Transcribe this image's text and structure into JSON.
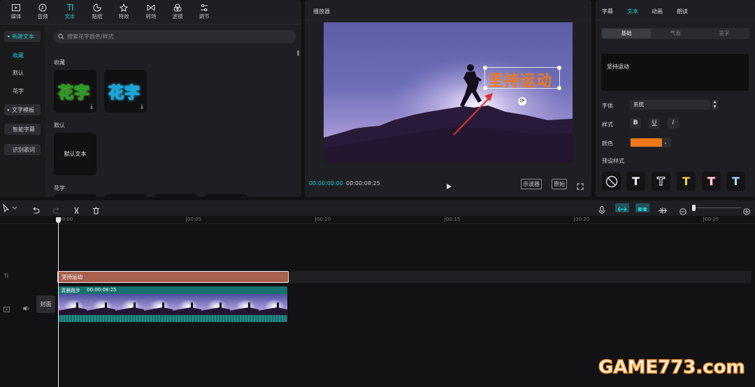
{
  "toolbar": {
    "items": [
      {
        "label": "媒体",
        "icon": "media-icon"
      },
      {
        "label": "音频",
        "icon": "audio-icon"
      },
      {
        "label": "文本",
        "icon": "text-icon",
        "active": true
      },
      {
        "label": "贴纸",
        "icon": "sticker-icon"
      },
      {
        "label": "特效",
        "icon": "effects-icon"
      },
      {
        "label": "转场",
        "icon": "transition-icon"
      },
      {
        "label": "滤镜",
        "icon": "filter-icon"
      },
      {
        "label": "调节",
        "icon": "adjust-icon"
      }
    ],
    "text_glyph": "TI"
  },
  "sidebar": {
    "items": [
      "新建文本",
      "收藏",
      "默认",
      "花字",
      "文字模板",
      "智能字幕",
      "识别歌词"
    ]
  },
  "library": {
    "search_placeholder": "搜索花字颜色/样式",
    "section_fav": "收藏",
    "fav_card1": "花字",
    "fav_card2": "花字",
    "section_default": "默认",
    "default_card": "默认文本",
    "section_huazi": "花字"
  },
  "player": {
    "title": "播放器",
    "overlay_text": "坚持运动",
    "time_current": "00:00:00:00",
    "time_total": "00:00:08:25",
    "btn_waveform": "示波器",
    "btn_original": "原始"
  },
  "inspector": {
    "tabs": [
      "字幕",
      "文本",
      "动画",
      "朗读"
    ],
    "active_tab": "文本",
    "subtabs": [
      "基础",
      "气泡",
      "花字"
    ],
    "text_value": "坚持运动",
    "font_label": "字体",
    "font_value": "系统",
    "style_label": "样式",
    "style_buttons": [
      "B",
      "U",
      "I"
    ],
    "color_label": "颜色",
    "color_value": "#f07818",
    "preset_label": "预设样式",
    "preset_glyph": "T"
  },
  "timeline": {
    "ticks": [
      "00:00",
      "00:05",
      "00:10",
      "00:15",
      "00:20",
      "00:25"
    ],
    "text_clip": "坚持运动",
    "video_clip_name": "清晨跑步",
    "video_clip_duration": "00:00:08:25",
    "cover_label": "封面",
    "text_track_glyph": "TI"
  },
  "watermark": {
    "text": "GAME773.com"
  }
}
